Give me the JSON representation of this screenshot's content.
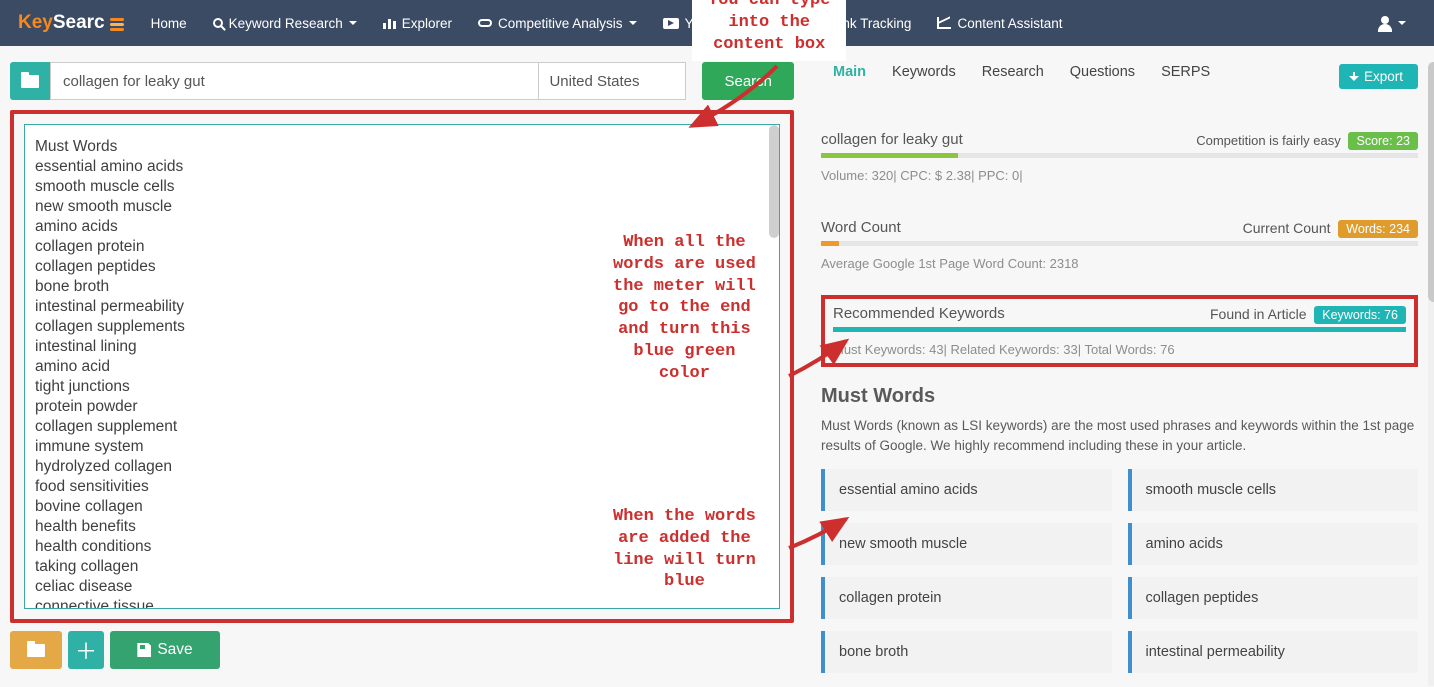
{
  "nav": {
    "logo_a": "Key",
    "logo_b": "Searc",
    "items": [
      "Home",
      "Keyword Research",
      "Explorer",
      "Competitive Analysis",
      "Youtube Research",
      "Rank Tracking",
      "Content Assistant"
    ],
    "has_caret": [
      false,
      true,
      false,
      true,
      true,
      false,
      false
    ]
  },
  "search": {
    "keyword": "collagen for leaky gut",
    "country": "United States",
    "search_btn": "Search",
    "save_btn": "Save"
  },
  "editor_lines": [
    "Must Words",
    "essential amino acids",
    "smooth muscle cells",
    "new smooth muscle",
    "amino acids",
    "collagen protein",
    "collagen peptides",
    "bone broth",
    "intestinal permeability",
    "collagen supplements",
    "intestinal lining",
    "amino acid",
    "tight junctions",
    "protein powder",
    "collagen supplement",
    "immune system",
    "hydrolyzed collagen",
    "food sensitivities",
    "bovine collagen",
    "health benefits",
    "health conditions",
    "taking collagen",
    "celiac disease",
    "connective tissue"
  ],
  "tabs": [
    "Main",
    "Keywords",
    "Research",
    "Questions",
    "SERPS"
  ],
  "export_label": "Export",
  "competition": {
    "keyword": "collagen for leaky gut",
    "note": "Competition is fairly easy",
    "score_label": "Score: 23",
    "vol_line": "Volume: 320| CPC: $ 2.38| PPC: 0|",
    "bar_pct": 23
  },
  "wordcount": {
    "title": "Word Count",
    "note": "Current Count",
    "badge": "Words: 234",
    "avg": "Average Google 1st Page Word Count: 2318",
    "bar_pct": 3
  },
  "rk": {
    "title": "Recommended Keywords",
    "note": "Found in Article",
    "badge": "Keywords: 76",
    "sub": "Must Keywords: 43| Related Keywords: 33| Total Words: 76",
    "bar_pct": 100
  },
  "must": {
    "heading": "Must Words",
    "desc": "Must Words (known as LSI keywords) are the most used phrases and keywords within the 1st page results of Google. We highly recommend including these in your article.",
    "grid": [
      [
        "essential amino acids",
        "smooth muscle cells"
      ],
      [
        "new smooth muscle",
        "amino acids"
      ],
      [
        "collagen protein",
        "collagen peptides"
      ],
      [
        "bone broth",
        "intestinal permeability"
      ]
    ]
  },
  "annotations": {
    "a1": "You can type\ninto the\ncontent box",
    "a2": "When all the\nwords are used\nthe meter will\ngo to the end\nand turn this\nblue green\ncolor",
    "a3": "When the words\nare added the\nline will turn\nblue"
  },
  "chart_data": [
    {
      "type": "bar",
      "title": "Competition Score",
      "categories": [
        "Score"
      ],
      "values": [
        23
      ],
      "ylim": [
        0,
        100
      ],
      "ylabel": "Competition"
    },
    {
      "type": "bar",
      "title": "Word Count",
      "categories": [
        "Current"
      ],
      "values": [
        234
      ],
      "ylim": [
        0,
        2318
      ],
      "ylabel": "Words",
      "annotations": [
        "Average 1st Page: 2318"
      ]
    },
    {
      "type": "bar",
      "title": "Recommended Keywords Found",
      "categories": [
        "Found"
      ],
      "values": [
        76
      ],
      "ylim": [
        0,
        76
      ],
      "ylabel": "Keywords",
      "annotations": [
        "Must: 43",
        "Related: 33",
        "Total: 76"
      ]
    }
  ]
}
